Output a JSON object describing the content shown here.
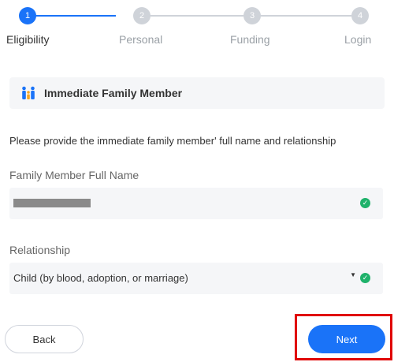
{
  "stepper": {
    "steps": [
      {
        "number": "1",
        "label": "Eligibility"
      },
      {
        "number": "2",
        "label": "Personal"
      },
      {
        "number": "3",
        "label": "Funding"
      },
      {
        "number": "4",
        "label": "Login"
      }
    ],
    "active_index": 0,
    "colors": {
      "active": "#1a73f8",
      "inactive": "#cfd3d9",
      "active_label": "#333333",
      "inactive_label": "#9aa0a6"
    }
  },
  "section": {
    "title": "Immediate Family Member",
    "icon": "family-icon"
  },
  "instruction": "Please provide the immediate family member' full name and relationship",
  "full_name_field": {
    "label": "Family Member Full Name",
    "status_icon": "check-circle-icon"
  },
  "relationship_field": {
    "label": "Relationship",
    "value": "Child (by blood, adoption, or marriage)",
    "status_icon": "check-circle-icon"
  },
  "buttons": {
    "back": "Back",
    "next": "Next"
  },
  "colors": {
    "primary": "#1a73f8",
    "success": "#1fb26b",
    "highlight": "#e00000"
  }
}
